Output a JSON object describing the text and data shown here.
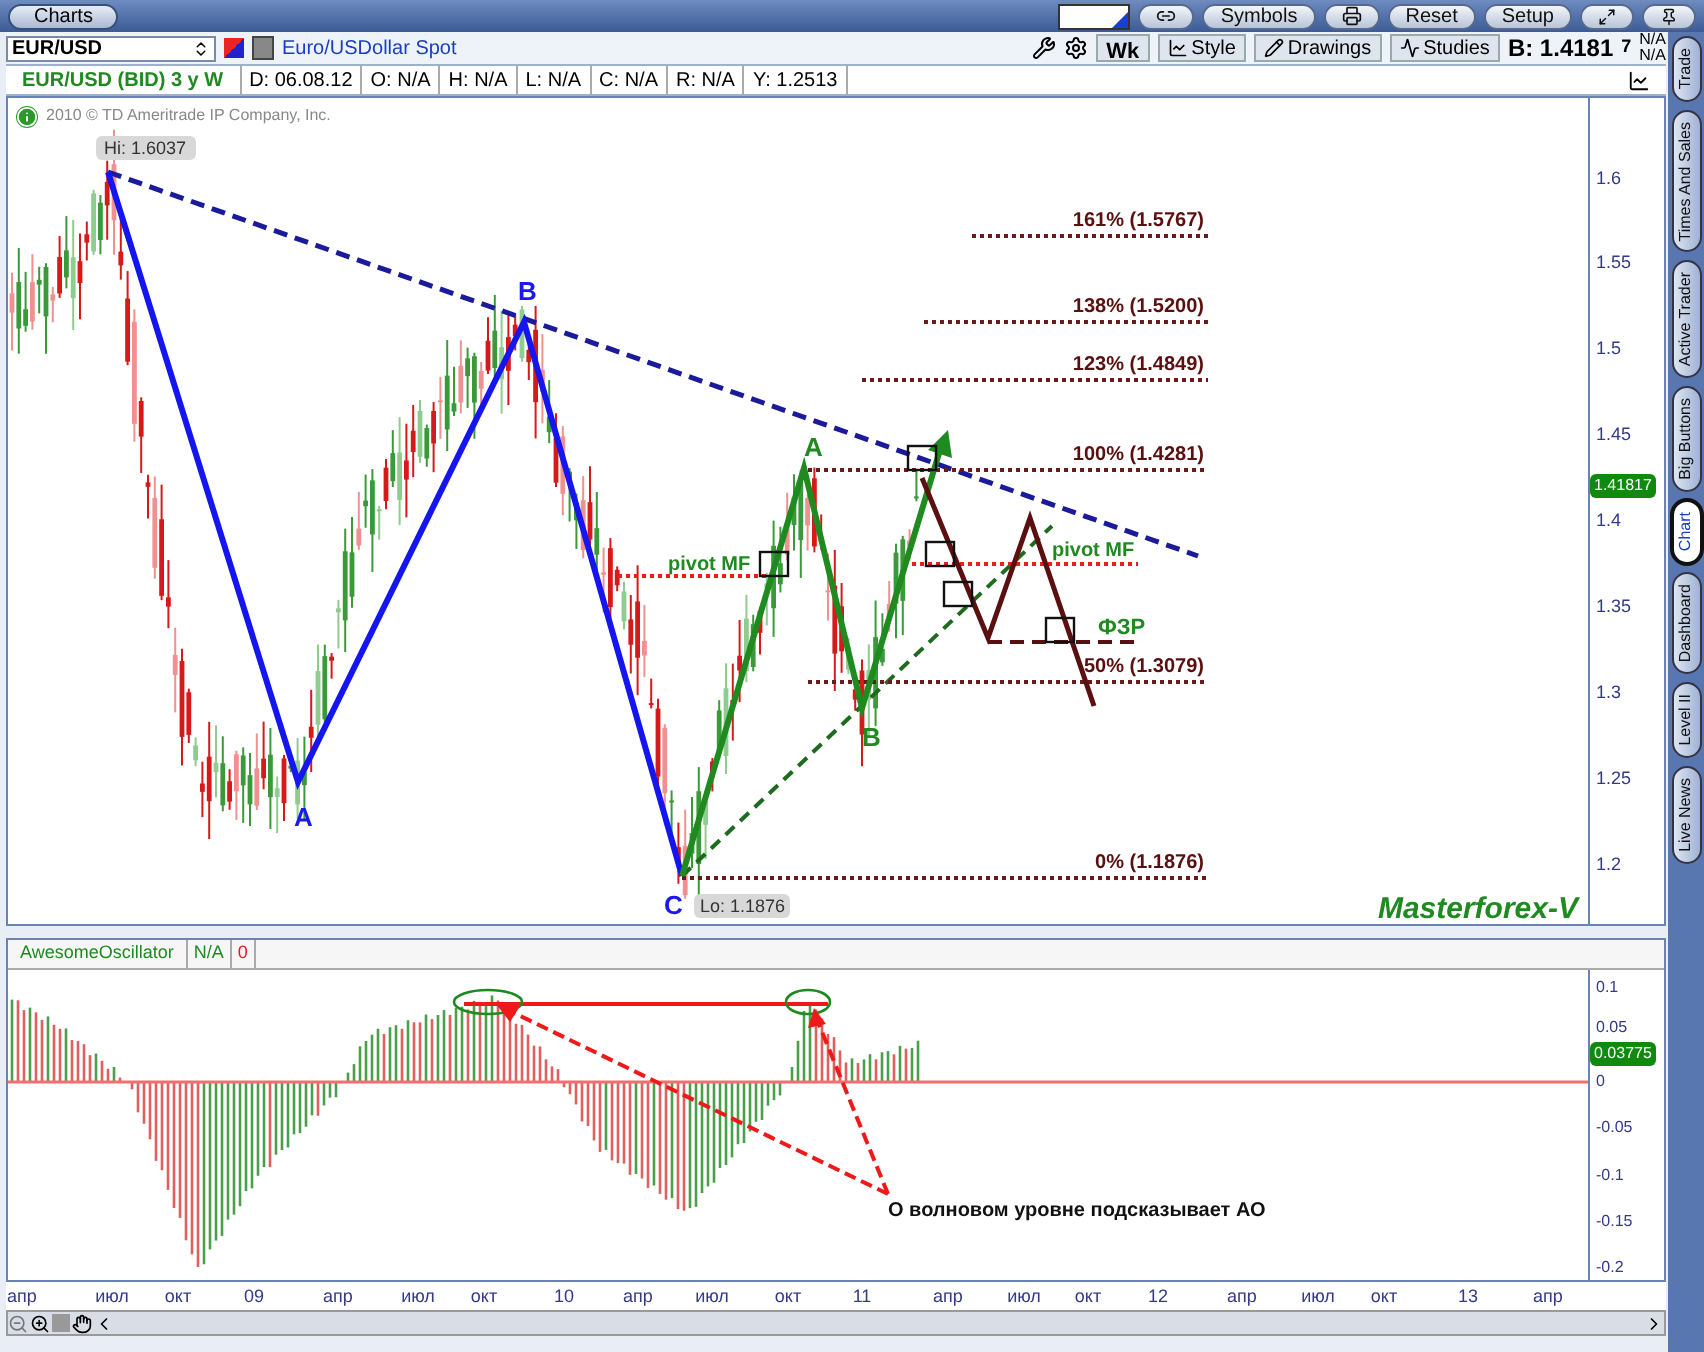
{
  "window": {
    "title": "Charts"
  },
  "top_buttons": [
    {
      "label": "Symbols",
      "kind": "text"
    },
    {
      "label": "Reset",
      "kind": "text"
    },
    {
      "label": "Setup",
      "kind": "text"
    }
  ],
  "toolbar": {
    "symbol": "EUR/USD",
    "description": "Euro/USDollar Spot",
    "period": "Wk",
    "buttons": [
      "Style",
      "Drawings",
      "Studies"
    ],
    "bid": "B: 1.4181",
    "bid_digit": "7",
    "side_values": [
      "N/A",
      "N/A"
    ]
  },
  "info": {
    "title": "EUR/USD (BID) 3 y W",
    "fields": [
      "D: 06.08.12",
      "O: N/A",
      "H: N/A",
      "L: N/A",
      "C: N/A",
      "R: N/A",
      "Y: 1.2513"
    ]
  },
  "copyright": "2010 © TD Ameritrade IP Company, Inc.",
  "price_chart": {
    "y_labels": [
      "1.6",
      "1.55",
      "1.5",
      "1.45",
      "1.4",
      "1.35",
      "1.3",
      "1.25",
      "1.2"
    ],
    "last_price": "1.41817",
    "hi_label": "Hi: 1.6037",
    "lo_label": "Lo: 1.1876",
    "wave_labels": [
      {
        "text": "A",
        "color": "#1a1af0"
      },
      {
        "text": "B",
        "color": "#1a1af0"
      },
      {
        "text": "C",
        "color": "#1a1af0"
      },
      {
        "text": "A",
        "color": "#1f8a1f"
      },
      {
        "text": "B",
        "color": "#1f8a1f"
      }
    ],
    "fib_levels": [
      "161% (1.5767)",
      "138% (1.5200)",
      "123% (1.4849)",
      "100% (1.4281)",
      "50% (1.3079)",
      "0% (1.1876)"
    ],
    "pivot_labels": [
      "pivot MF",
      "pivot MF"
    ],
    "fzr_label": "ФЗР",
    "signature": "Masterforex-V"
  },
  "oscillator": {
    "title": "AwesomeOscillator",
    "status": "N/A",
    "value": "0",
    "y_labels": [
      "0.1",
      "0.05",
      "0",
      "-0.05",
      "-0.1",
      "-0.15",
      "-0.2"
    ],
    "last_value": "0.03775",
    "note": "О волновом уровне подсказывает АО"
  },
  "x_labels": [
    "апр",
    "июл",
    "окт",
    "09",
    "апр",
    "июл",
    "окт",
    "10",
    "апр",
    "июл",
    "окт",
    "11",
    "апр",
    "июл",
    "окт",
    "12",
    "апр",
    "июл",
    "окт",
    "13",
    "апр"
  ],
  "side_tabs": [
    {
      "label": "Trade",
      "selected": false
    },
    {
      "label": "Times And Sales",
      "selected": false
    },
    {
      "label": "Active Trader",
      "selected": false
    },
    {
      "label": "Big Buttons",
      "selected": false
    },
    {
      "label": "Chart",
      "selected": true
    },
    {
      "label": "Dashboard",
      "selected": false
    },
    {
      "label": "Level II",
      "selected": false
    },
    {
      "label": "Live News",
      "selected": false
    }
  ]
}
